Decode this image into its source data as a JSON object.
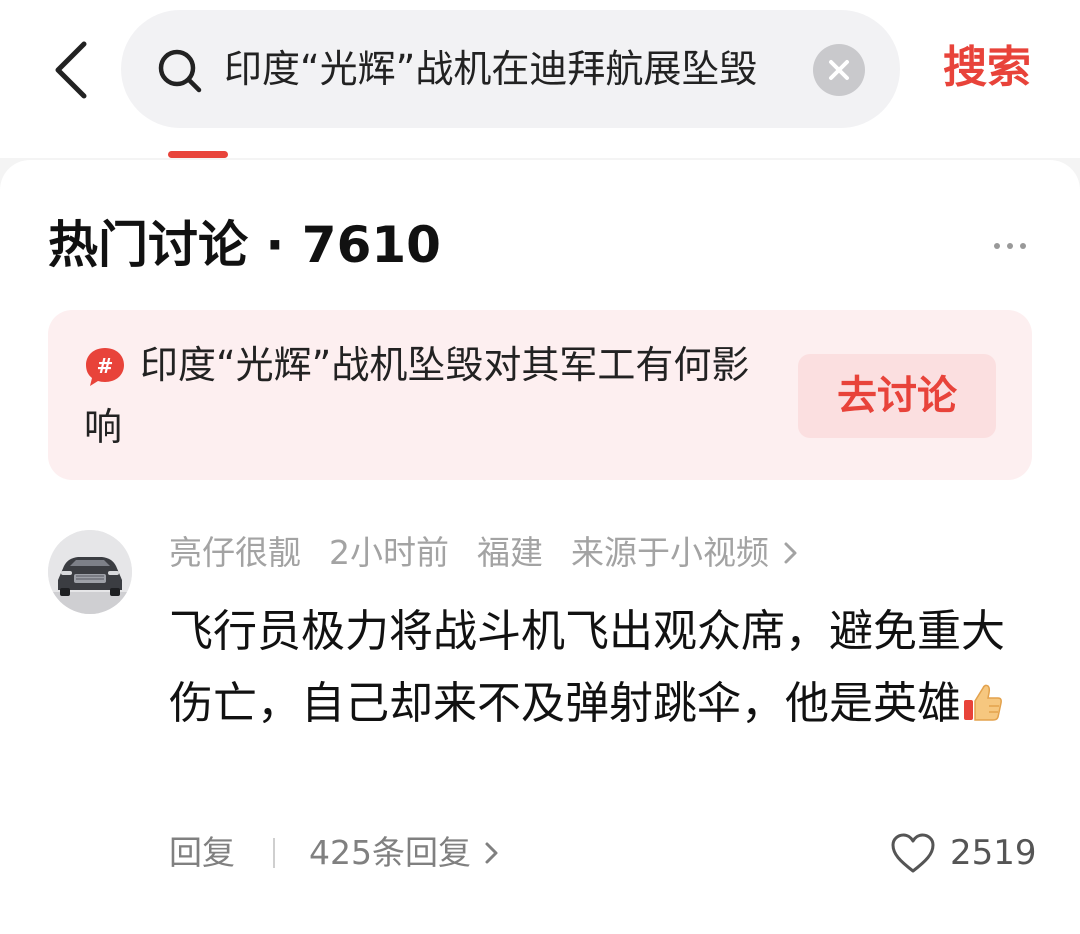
{
  "search": {
    "query": "印度“光辉”战机在迪拜航展坠毁",
    "submit_label": "搜索"
  },
  "section": {
    "title": "热门讨论 · 7610"
  },
  "topic": {
    "title": "印度“光辉”战机坠毁对其军工有何影响",
    "action_label": "去讨论"
  },
  "comment": {
    "author": "亮仔很靓",
    "time": "2小时前",
    "location": "福建",
    "source": "来源于小视频",
    "text": "飞行员极力将战斗机飞出观众席，避免重大伤亡，自己却来不及弹射跳伞，他是英雄",
    "reply_label": "回复",
    "replies_label": "425条回复",
    "likes": "2519"
  },
  "colors": {
    "accent": "#e8433a",
    "topic_bg": "#fdeff0",
    "search_bg": "#f2f2f4"
  },
  "icons": [
    "back-icon",
    "search-icon",
    "clear-icon",
    "more-icon",
    "hashtag-icon",
    "thumbs-up-icon",
    "chevron-right-icon",
    "heart-icon"
  ]
}
